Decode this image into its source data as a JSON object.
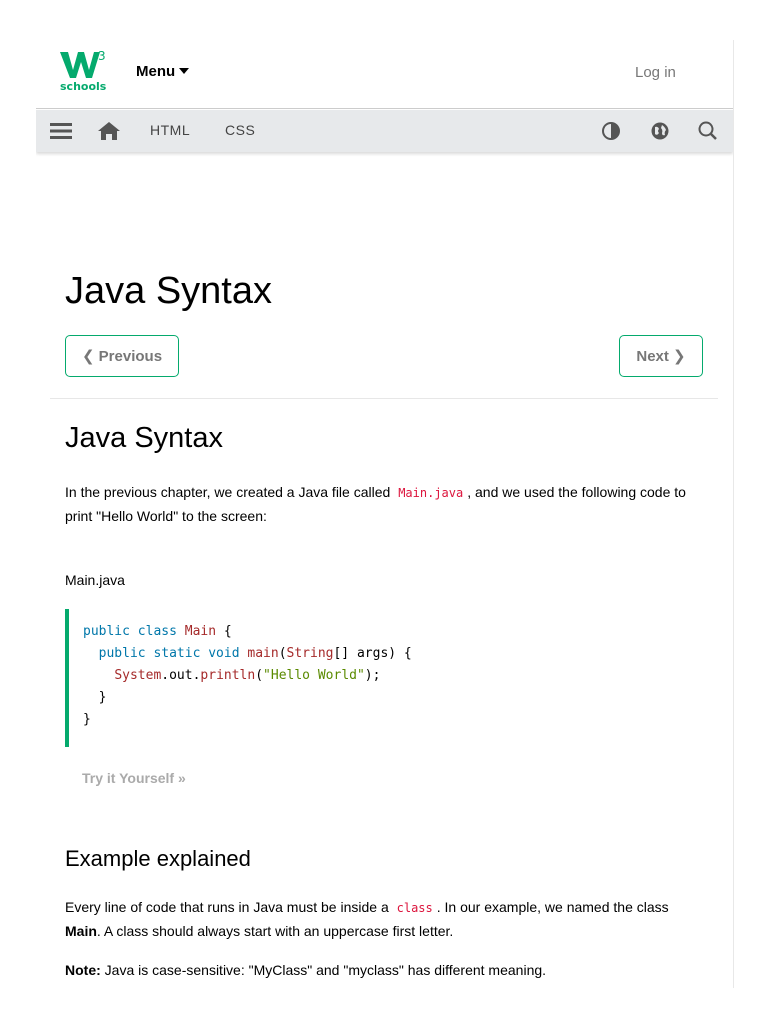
{
  "brand": {
    "logo_mark": "W3",
    "logo_text": "schools",
    "accent_color": "#04AA6D"
  },
  "header": {
    "menu_label": "Menu",
    "login_label": "Log in"
  },
  "navbar": {
    "items": [
      {
        "icon": "hamburger-icon"
      },
      {
        "icon": "home-icon"
      },
      {
        "label": "HTML"
      },
      {
        "label": "CSS"
      }
    ],
    "right_icons": [
      "contrast-icon",
      "globe-icon",
      "search-icon"
    ]
  },
  "main": {
    "page_title": "Java Syntax",
    "prev_label": "❮ Previous",
    "next_label": "Next ❯",
    "section_title": "Java Syntax",
    "intro_part1": "In the previous chapter, we created a Java file called ",
    "intro_code": "Main.java",
    "intro_part2": ", and we used the following code to print \"Hello World\" to the screen:",
    "example_filename": "Main.java",
    "try_label": "Try it Yourself »",
    "explained_title": "Example explained",
    "explained_part1": "Every line of code that runs in Java must be inside a ",
    "explained_code": "class",
    "explained_part2": ". In our example, we named the class ",
    "explained_bold": "Main",
    "explained_part3": ". A class should always start with an uppercase first letter.",
    "note_label": "Note:",
    "note_text": " Java is case-sensitive: \"MyClass\" and \"myclass\" has different meaning."
  }
}
